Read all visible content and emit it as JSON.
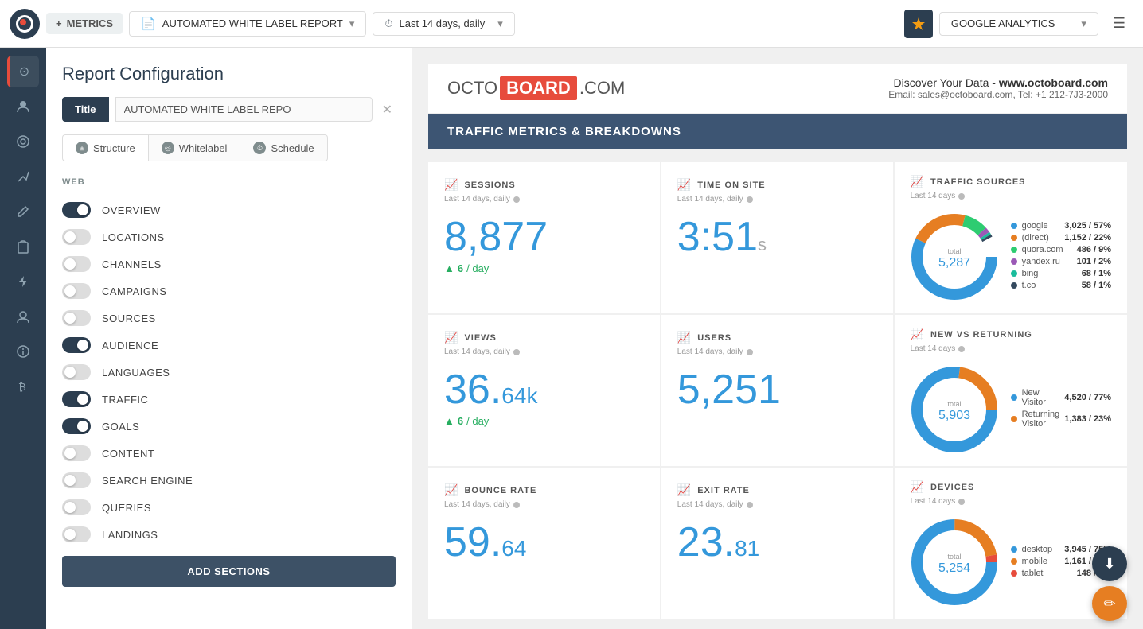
{
  "topNav": {
    "logoAlt": "Octoboard Logo",
    "metricsLabel": "METRICS",
    "reportTitle": "AUTOMATED WHITE LABEL REPORT",
    "timeRange": "Last 14 days, daily",
    "analyticsSource": "GOOGLE ANALYTICS",
    "plusIcon": "+",
    "caretIcon": "▾",
    "clockIcon": "🕐",
    "hamburgerIcon": "☰"
  },
  "sidebarIcons": [
    {
      "name": "home-icon",
      "symbol": "⊙"
    },
    {
      "name": "people-icon",
      "symbol": "👤"
    },
    {
      "name": "analytics-icon",
      "symbol": "◎"
    },
    {
      "name": "connections-icon",
      "symbol": "↗"
    },
    {
      "name": "pencil-icon",
      "symbol": "✏"
    },
    {
      "name": "clipboard-icon",
      "symbol": "📋"
    },
    {
      "name": "lightning-icon",
      "symbol": "⚡"
    },
    {
      "name": "user-icon",
      "symbol": "👤"
    },
    {
      "name": "info-icon",
      "symbol": "ℹ"
    },
    {
      "name": "bitcoin-icon",
      "symbol": "₿"
    }
  ],
  "leftPanel": {
    "panelTitle": "Report Configuration",
    "titleTabLabel": "Title",
    "titleValue": "AUTOMATED WHITE LABEL REPO",
    "tabs": [
      {
        "id": "structure",
        "label": "Structure",
        "active": true
      },
      {
        "id": "whitelabel",
        "label": "Whitelabel",
        "active": false
      },
      {
        "id": "schedule",
        "label": "Schedule",
        "active": false
      }
    ],
    "sections": {
      "web": {
        "label": "WEB",
        "items": [
          {
            "id": "overview",
            "label": "OVERVIEW",
            "enabled": true
          },
          {
            "id": "locations",
            "label": "LOCATIONS",
            "enabled": false
          },
          {
            "id": "channels",
            "label": "CHANNELS",
            "enabled": false
          },
          {
            "id": "campaigns",
            "label": "CAMPAIGNS",
            "enabled": false
          },
          {
            "id": "sources",
            "label": "SOURCES",
            "enabled": false
          },
          {
            "id": "audience",
            "label": "AUDIENCE",
            "enabled": true
          },
          {
            "id": "languages",
            "label": "LANGUAGES",
            "enabled": false
          },
          {
            "id": "traffic",
            "label": "TRAFFIC",
            "enabled": true
          },
          {
            "id": "goals",
            "label": "GOALS",
            "enabled": true
          },
          {
            "id": "content",
            "label": "CONTENT",
            "enabled": false
          },
          {
            "id": "searchEngine",
            "label": "SEARCH ENGINE",
            "enabled": false
          },
          {
            "id": "queries",
            "label": "QUERIES",
            "enabled": false
          },
          {
            "id": "landings",
            "label": "LANDINGS",
            "enabled": false
          }
        ]
      }
    },
    "addSectionsLabel": "ADD SECTIONS"
  },
  "rightPanel": {
    "logo": {
      "prefix": "OCTO",
      "highlight": "BOARD",
      "suffix": ".COM"
    },
    "contact": {
      "discoverText": "Discover Your Data - ",
      "website": "www.octoboard.com",
      "emailLabel": "Email: ",
      "email": "sales@octoboard.com",
      "telLabel": "Tel: ",
      "tel": "+1 212-7J3-2000"
    },
    "sectionTitle": "TRAFFIC METRICS & BREAKDOWNS",
    "metrics": [
      {
        "id": "sessions",
        "name": "SESSIONS",
        "period": "Last 14 days, daily",
        "value": "8,877",
        "subValue": "6",
        "subLabel": "/ day",
        "subDir": "up",
        "type": "number"
      },
      {
        "id": "timeOnSite",
        "name": "TIME ON SITE",
        "period": "Last 14 days, daily",
        "value": "3:51",
        "valueSuffix": "s",
        "type": "time"
      },
      {
        "id": "trafficSources",
        "name": "TRAFFIC SOURCES",
        "period": "Last 14 days",
        "type": "donut",
        "total": "5,287",
        "legend": [
          {
            "name": "google",
            "color": "#3498db",
            "val": "3,025",
            "pct": "57%"
          },
          {
            "name": "(direct)",
            "color": "#e67e22",
            "val": "1,152",
            "pct": "22%"
          },
          {
            "name": "quora.com",
            "color": "#2ecc71",
            "val": "486",
            "pct": "9%"
          },
          {
            "name": "yandex.ru",
            "color": "#9b59b6",
            "val": "101",
            "pct": "2%"
          },
          {
            "name": "bing",
            "color": "#1abc9c",
            "val": "68",
            "pct": "1%"
          },
          {
            "name": "t.co",
            "color": "#34495e",
            "val": "58",
            "pct": "1%"
          }
        ],
        "donutSegments": [
          {
            "pct": 57,
            "color": "#3498db"
          },
          {
            "pct": 22,
            "color": "#e67e22"
          },
          {
            "pct": 9,
            "color": "#2ecc71"
          },
          {
            "pct": 2,
            "color": "#9b59b6"
          },
          {
            "pct": 1,
            "color": "#1abc9c"
          },
          {
            "pct": 1,
            "color": "#34495e"
          }
        ]
      },
      {
        "id": "views",
        "name": "VIEWS",
        "period": "Last 14 days, daily",
        "value": "36.",
        "valueDecimal": "64k",
        "subValue": "6",
        "subLabel": "/ day",
        "subDir": "up",
        "type": "number2"
      },
      {
        "id": "users",
        "name": "USERS",
        "period": "Last 14 days, daily",
        "value": "5,251",
        "type": "number"
      },
      {
        "id": "newVsReturning",
        "name": "NEW VS RETURNING",
        "period": "Last 14 days",
        "type": "donut",
        "total": "5,903",
        "legend": [
          {
            "name": "New Visitor",
            "color": "#3498db",
            "val": "4,520",
            "pct": "77%"
          },
          {
            "name": "Returning Visitor",
            "color": "#e67e22",
            "val": "1,383",
            "pct": "23%"
          }
        ],
        "donutSegments": [
          {
            "pct": 77,
            "color": "#3498db"
          },
          {
            "pct": 23,
            "color": "#e67e22"
          }
        ]
      },
      {
        "id": "bounceRate",
        "name": "BOUNCE RATE",
        "period": "Last 14 days, daily",
        "value": "59.",
        "valueDecimal": "64",
        "type": "number2"
      },
      {
        "id": "exitRate",
        "name": "EXIT RATE",
        "period": "Last 14 days, daily",
        "value": "23.",
        "valueDecimal": "81",
        "type": "number2"
      },
      {
        "id": "devices",
        "name": "DEVICES",
        "period": "Last 14 days",
        "type": "donut",
        "total": "5,254",
        "legend": [
          {
            "name": "desktop",
            "color": "#3498db",
            "val": "3,945",
            "pct": "75%"
          },
          {
            "name": "mobile",
            "color": "#e67e22",
            "val": "1,161",
            "pct": "22%"
          },
          {
            "name": "tablet",
            "color": "#e74c3c",
            "val": "148",
            "pct": "3%"
          }
        ],
        "donutSegments": [
          {
            "pct": 75,
            "color": "#3498db"
          },
          {
            "pct": 22,
            "color": "#e67e22"
          },
          {
            "pct": 3,
            "color": "#e74c3c"
          }
        ]
      }
    ]
  },
  "fabs": {
    "downloadLabel": "⬇",
    "editLabel": "✏"
  }
}
